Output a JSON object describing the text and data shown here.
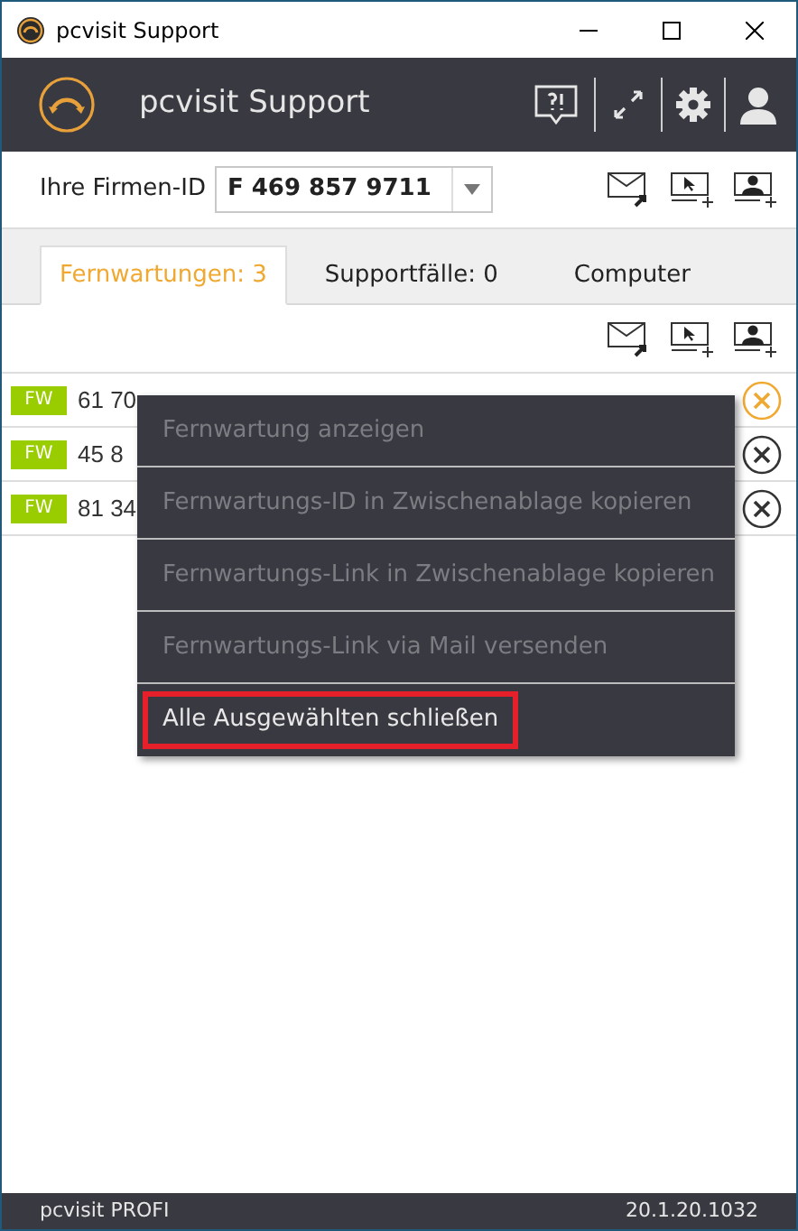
{
  "window": {
    "title": "pcvisit Support"
  },
  "header": {
    "title": "pcvisit Support"
  },
  "company_id": {
    "label": "Ihre Firmen-ID",
    "value": "F 469 857 9711"
  },
  "tabs": [
    {
      "label": "Fernwartungen: 3",
      "selected": true
    },
    {
      "label": "Supportfälle: 0",
      "selected": false
    },
    {
      "label": "Computer",
      "selected": false
    }
  ],
  "rows": [
    {
      "badge": "FW",
      "text": "61 70",
      "highlighted": true
    },
    {
      "badge": "FW",
      "text": "45 8",
      "highlighted": false
    },
    {
      "badge": "FW",
      "text": "81 34",
      "highlighted": false
    }
  ],
  "context_menu": [
    {
      "label": "Fernwartung anzeigen",
      "disabled": true,
      "highlighted": false
    },
    {
      "label": "Fernwartungs-ID in Zwischenablage kopieren",
      "disabled": true,
      "highlighted": false
    },
    {
      "label": "Fernwartungs-Link in Zwischenablage kopieren",
      "disabled": true,
      "highlighted": false
    },
    {
      "label": "Fernwartungs-Link via Mail versenden",
      "disabled": true,
      "highlighted": false
    },
    {
      "label": "Alle Ausgewählten schließen",
      "disabled": false,
      "highlighted": true
    }
  ],
  "status_bar": {
    "edition": "pcvisit PROFI",
    "version": "20.1.20.1032"
  }
}
